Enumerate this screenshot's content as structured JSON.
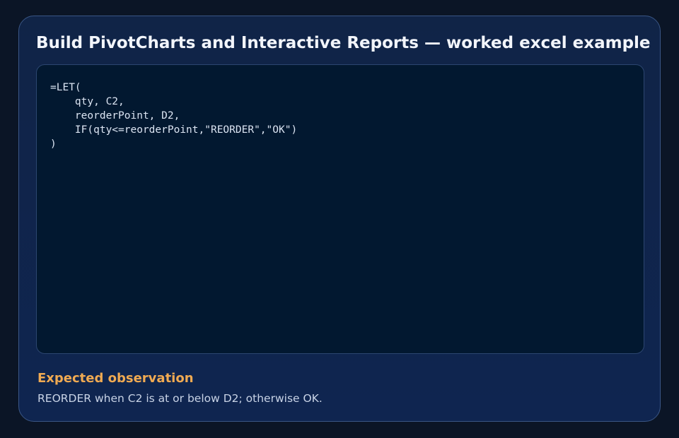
{
  "card": {
    "title": "Build PivotCharts and Interactive Reports — worked excel example"
  },
  "code": {
    "text": "=LET(\n    qty, C2,\n    reorderPoint, D2,\n    IF(qty<=reorderPoint,\"REORDER\",\"OK\")\n)"
  },
  "observation": {
    "heading": "Expected observation",
    "text": "REORDER when C2 is at or below D2; otherwise OK."
  },
  "colors": {
    "background": "#0b1526",
    "card": "#102447",
    "code_background": "#021830",
    "accent": "#f0aa52",
    "title": "#f2f5fb"
  }
}
